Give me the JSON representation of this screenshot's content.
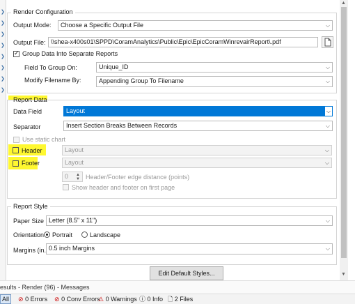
{
  "render_config": {
    "legend": "Render Configuration",
    "output_mode_label": "Output Mode:",
    "output_mode_value": "Choose a Specific Output File",
    "output_file_label": "Output File:",
    "output_file_value": "\\\\shea-x400s01\\SPPD\\CoramAnalytics\\Public\\Epic\\EpicCoramWinrevairReport\\.pdf",
    "group_checkbox_label": "Group Data Into Separate Reports",
    "group_checked": true,
    "field_to_group_label": "Field To Group On:",
    "field_to_group_value": "Unique_ID",
    "modify_filename_label": "Modify Filename By:",
    "modify_filename_value": "Appending Group To Filename"
  },
  "report_data": {
    "legend": "Report Data",
    "data_field_label": "Data Field",
    "data_field_value": "Layout",
    "separator_label": "Separator",
    "separator_value": "Insert Section Breaks Between Records",
    "use_static_chart_label": "Use static chart",
    "header_label": "Header",
    "header_value": "Layout",
    "footer_label": "Footer",
    "footer_value": "Layout",
    "distance_value": "0",
    "distance_label": "Header/Footer edge distance (points)",
    "show_header_footer_label": "Show header and footer on first page"
  },
  "report_style": {
    "legend": "Report Style",
    "paper_size_label": "Paper Size",
    "paper_size_value": "Letter (8.5\" x 11\")",
    "orientation_label": "Orientation",
    "orientation_options": [
      "Portrait",
      "Landscape"
    ],
    "orientation_selected": "Portrait",
    "margins_label": "Margins (in.)",
    "margins_value": "0.5 inch Margins",
    "edit_styles_button": "Edit Default Styles..."
  },
  "bottom_tabs": {
    "text": "esults - Render (96) - Messages"
  },
  "results_bar": {
    "all": "All",
    "errors": "0 Errors",
    "conv_errors": "0 Conv Errors",
    "warnings": "0 Warnings",
    "info": "0 Info",
    "files": "2 Files"
  },
  "colors": {
    "highlight": "#fff830",
    "selection": "#0078d7"
  }
}
